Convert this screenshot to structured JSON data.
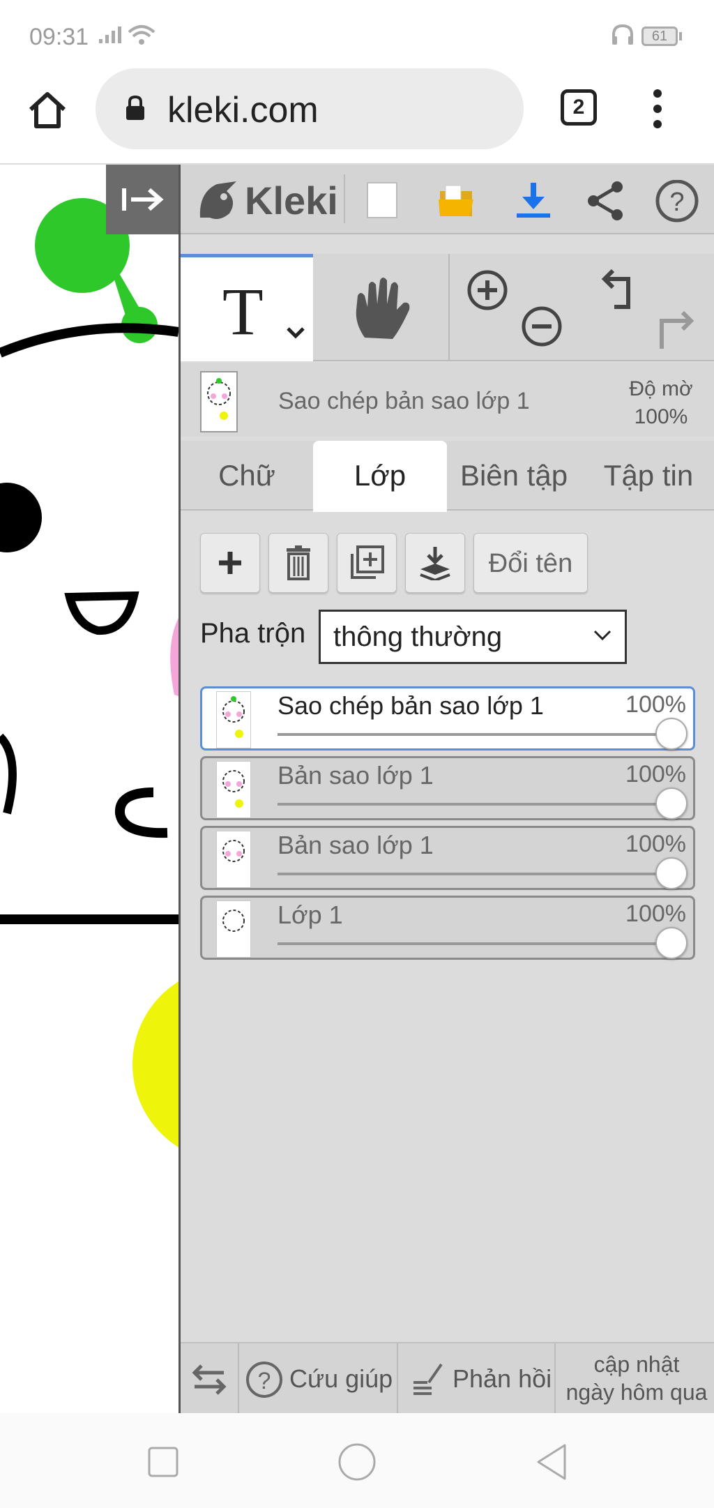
{
  "status_bar": {
    "time": "09:31",
    "battery": "61"
  },
  "browser": {
    "url": "kleki.com",
    "tab_count": "2"
  },
  "app": {
    "logo_text": "Kleki",
    "current_layer": {
      "name": "Sao chép bản sao lớp 1",
      "opacity_label": "Độ mờ",
      "opacity_value": "100%"
    },
    "tabs": [
      "Chữ",
      "Lớp",
      "Biên tập",
      "Tập tin"
    ],
    "active_tab": "Lớp",
    "rename_label": "Đổi tên",
    "blend_label": "Pha trộn",
    "blend_value": "thông thường",
    "layers": [
      {
        "name": "Sao chép bản sao lớp 1",
        "opacity": "100%",
        "active": true
      },
      {
        "name": "Bản sao lớp 1",
        "opacity": "100%",
        "active": false
      },
      {
        "name": "Bản sao lớp 1",
        "opacity": "100%",
        "active": false
      },
      {
        "name": "Lớp 1",
        "opacity": "100%",
        "active": false
      }
    ],
    "footer": {
      "help_label": "Cứu giúp",
      "feedback_label": "Phản hồi",
      "update_line1": "cập nhật",
      "update_line2": "ngày hôm qua"
    }
  },
  "colors": {
    "accent": "#5a8fd6",
    "panel_bg": "#dcdcdc",
    "download_blue": "#1a73e8",
    "folder_yellow": "#f4b400",
    "canvas_green": "#2ec82a",
    "canvas_yellow": "#eef50a",
    "canvas_pink": "#f4a6d8"
  }
}
